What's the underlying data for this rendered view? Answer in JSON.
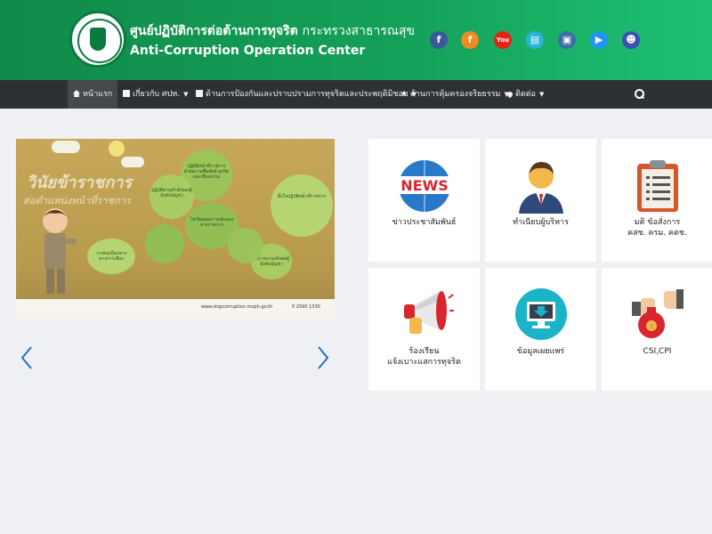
{
  "header": {
    "title_th": "ศูนย์ปฏิบัติการต่อต้านการทุจริต",
    "ministry_th": "กระทรวงสาธารณสุข",
    "title_en": "Anti-Corruption Operation Center",
    "social": [
      {
        "icon": "facebook-icon",
        "glyph": "f",
        "color": "#3b5998"
      },
      {
        "icon": "facebook-messenger-icon",
        "glyph": "f",
        "color": "#f08a24"
      },
      {
        "icon": "youtube-icon",
        "glyph": "You",
        "color": "#e62117"
      },
      {
        "icon": "printer-icon",
        "glyph": "▤",
        "color": "#2bb3d9"
      },
      {
        "icon": "photo-icon",
        "glyph": "▣",
        "color": "#3a6ea5"
      },
      {
        "icon": "video-icon",
        "glyph": "▶",
        "color": "#2196f3"
      },
      {
        "icon": "users-icon",
        "glyph": "☻",
        "color": "#3f51b5"
      }
    ]
  },
  "nav": {
    "items": [
      {
        "label": "หน้าแรก",
        "icon": "home-icon",
        "dropdown": false,
        "active": true
      },
      {
        "label": "เกี่ยวกับ ศปท.",
        "icon": "building-icon",
        "dropdown": true,
        "active": false
      },
      {
        "label": "ด้านการป้องกันและปราบปรามการทุจริตและประพฤติมิชอบ",
        "icon": "document-icon",
        "dropdown": true,
        "active": false
      },
      {
        "label": "ด้านการคุ้มครองจริยธรรม",
        "icon": "star-icon",
        "dropdown": true,
        "active": false
      },
      {
        "label": "ติดต่อ",
        "icon": "map-marker-icon",
        "dropdown": true,
        "active": false
      }
    ],
    "caret": "▼"
  },
  "banner": {
    "title": "วินัยข้าราชการ",
    "subtitle": "ต่อตำแหน่งหน้าที่ราชการ",
    "bubbles": [
      "ปฏิบัติหน้าที่ราชการด้วยความซื่อสัตย์ สุจริต และเที่ยงธรรม",
      "ปฏิบัติตามคำสั่งของผู้บังคับบัญชา",
      "ไม่เปิดเผยความลับของทางราชการ",
      "ตั้งใจปฏิบัติหน้าที่ราชการ",
      "ไม่รายงานเท็จต่อผู้บังคับบัญชา",
      "วางตนเป็นกลางทางการเมือง"
    ],
    "url": "www.stopcorruption.moph.go.th",
    "phone": "0 2590 1330"
  },
  "carousel": {
    "prev_glyph": "‹",
    "next_glyph": "›"
  },
  "tiles": [
    {
      "label_lines": [
        "ข่าวประชาสัมพันธ์"
      ],
      "icon": "news-icon"
    },
    {
      "label_lines": [
        "ทำเนียบผู้บริหาร"
      ],
      "icon": "executive-icon"
    },
    {
      "label_lines": [
        "มติ ข้อสั่งการ",
        "คสช. ครม. คตช."
      ],
      "icon": "clipboard-icon"
    },
    {
      "label_lines": [
        "ร้องเรียน",
        "แจ้งเบาะแสการทุจริต"
      ],
      "icon": "megaphone-icon"
    },
    {
      "label_lines": [
        "ข้อมูลเผยแพร่"
      ],
      "icon": "download-monitor-icon"
    },
    {
      "label_lines": [
        "CSI,CPI"
      ],
      "icon": "bribe-refuse-icon"
    }
  ]
}
